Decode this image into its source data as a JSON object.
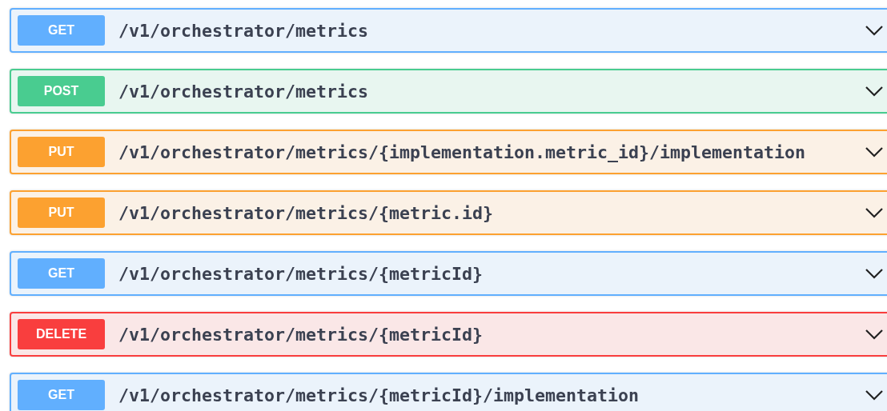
{
  "operations": [
    {
      "method": "GET",
      "kind": "get",
      "path": "/v1/orchestrator/metrics",
      "expanded": false
    },
    {
      "method": "POST",
      "kind": "post",
      "path": "/v1/orchestrator/metrics",
      "expanded": false
    },
    {
      "method": "PUT",
      "kind": "put",
      "path": "/v1/orchestrator/metrics/{implementation.metric_id}/implementation",
      "expanded": false
    },
    {
      "method": "PUT",
      "kind": "put",
      "path": "/v1/orchestrator/metrics/{metric.id}",
      "expanded": false
    },
    {
      "method": "GET",
      "kind": "get",
      "path": "/v1/orchestrator/metrics/{metricId}",
      "expanded": false
    },
    {
      "method": "DELETE",
      "kind": "delete",
      "path": "/v1/orchestrator/metrics/{metricId}",
      "expanded": false
    },
    {
      "method": "GET",
      "kind": "get",
      "path": "/v1/orchestrator/metrics/{metricId}/implementation",
      "expanded": false
    }
  ]
}
